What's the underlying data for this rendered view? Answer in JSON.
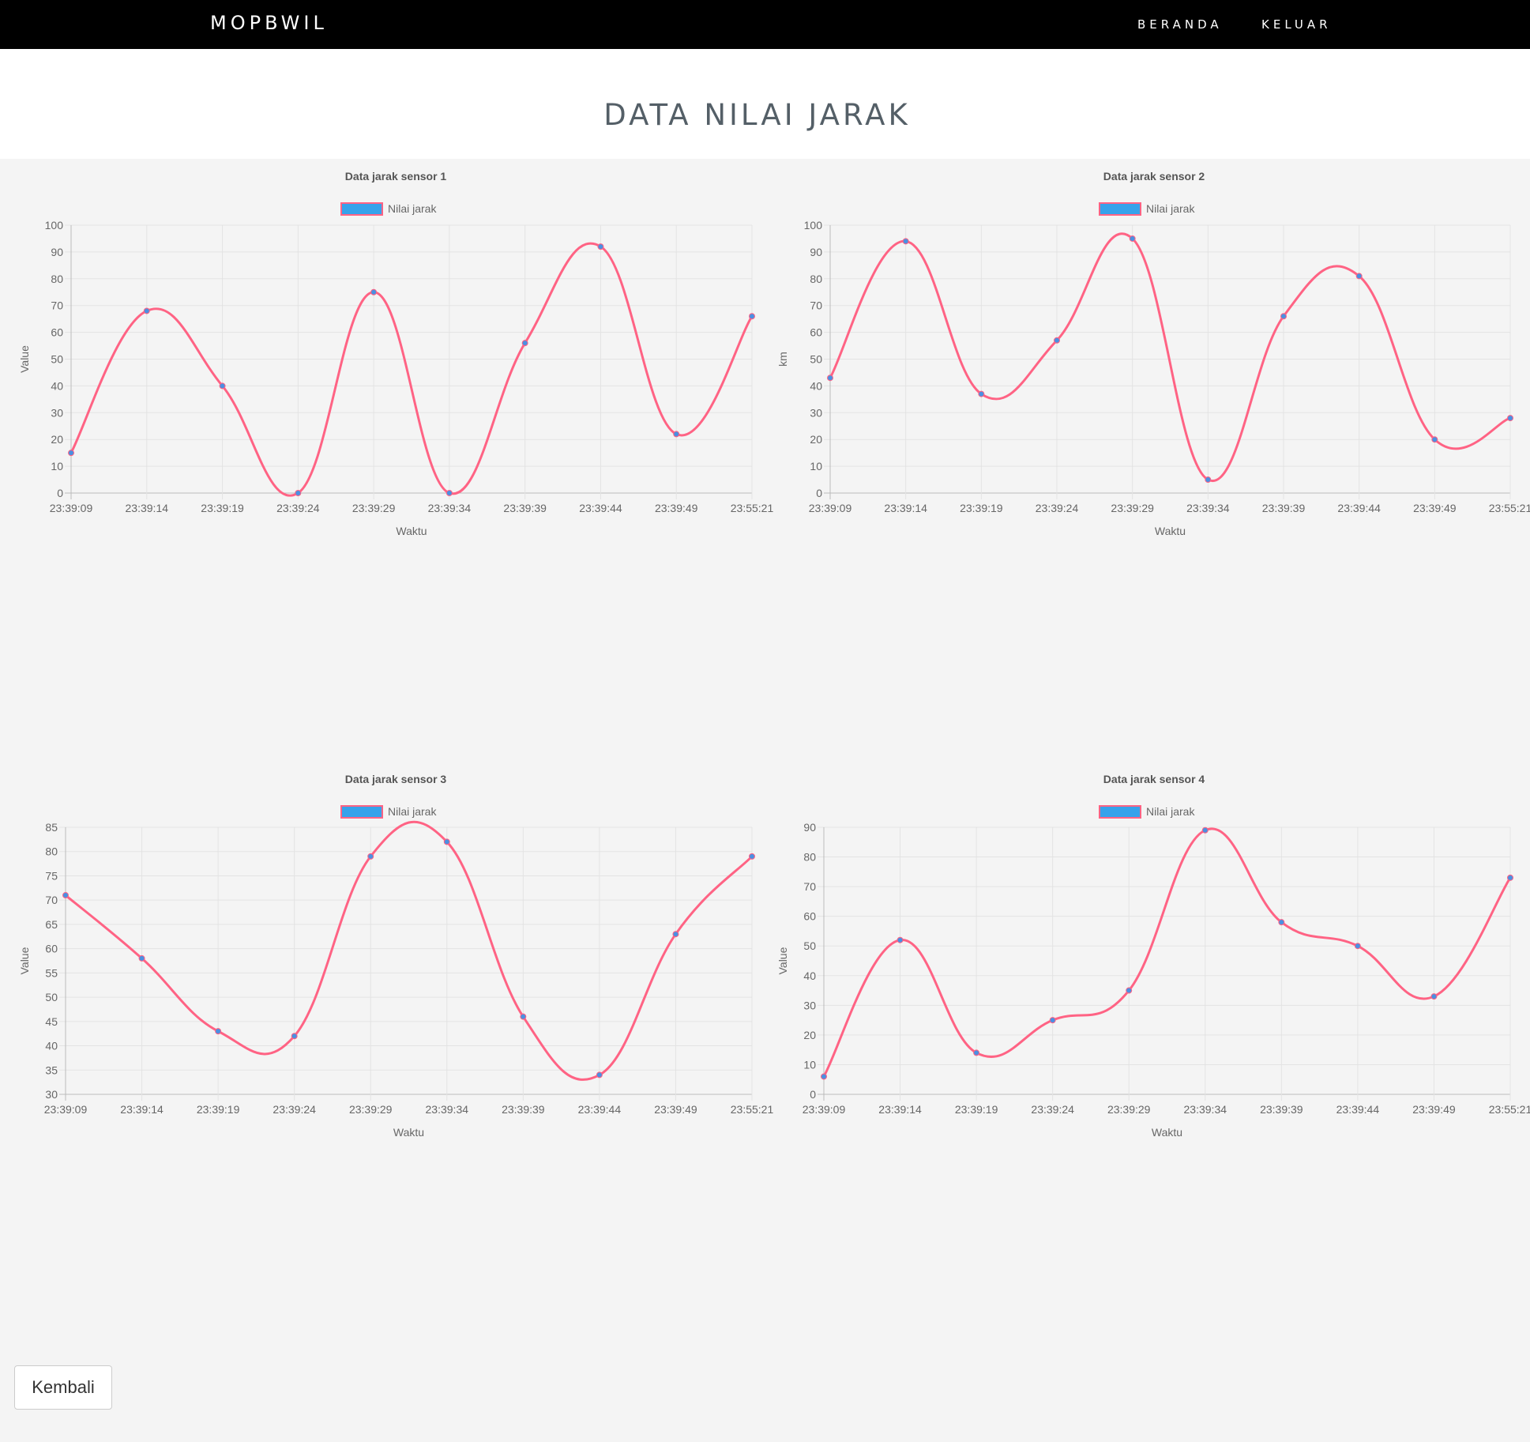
{
  "navbar": {
    "brand": "MOPBWIL",
    "links": [
      "BERANDA",
      "KELUAR"
    ]
  },
  "page_title": "DATA NILAI JARAK",
  "back_button_label": "Kembali",
  "colors": {
    "line": "#ff6384",
    "point": "#4a90e2",
    "legend_fill": "#36a2eb",
    "navbar_bg": "#000000",
    "background": "#f4f4f4"
  },
  "chart_data": [
    {
      "type": "line",
      "title": "Data jarak sensor 1",
      "legend": "Nilai jarak",
      "xlabel": "Waktu",
      "ylabel": "Value",
      "categories": [
        "23:39:09",
        "23:39:14",
        "23:39:19",
        "23:39:24",
        "23:39:29",
        "23:39:34",
        "23:39:39",
        "23:39:44",
        "23:39:49",
        "23:55:21"
      ],
      "series": [
        {
          "name": "Nilai jarak",
          "values": [
            15,
            68,
            40,
            0,
            75,
            0,
            56,
            92,
            22,
            66
          ]
        }
      ],
      "ylim": [
        0,
        100
      ],
      "yticks": [
        0,
        10,
        20,
        30,
        40,
        50,
        60,
        70,
        80,
        90,
        100
      ],
      "grid": true,
      "legend_position": "top"
    },
    {
      "type": "line",
      "title": "Data jarak sensor 2",
      "legend": "Nilai jarak",
      "xlabel": "Waktu",
      "ylabel": "km",
      "categories": [
        "23:39:09",
        "23:39:14",
        "23:39:19",
        "23:39:24",
        "23:39:29",
        "23:39:34",
        "23:39:39",
        "23:39:44",
        "23:39:49",
        "23:55:21"
      ],
      "series": [
        {
          "name": "Nilai jarak",
          "values": [
            43,
            94,
            37,
            57,
            95,
            5,
            66,
            81,
            20,
            28
          ]
        }
      ],
      "ylim": [
        0,
        100
      ],
      "yticks": [
        0,
        10,
        20,
        30,
        40,
        50,
        60,
        70,
        80,
        90,
        100
      ],
      "grid": true,
      "legend_position": "top"
    },
    {
      "type": "line",
      "title": "Data jarak sensor 3",
      "legend": "Nilai jarak",
      "xlabel": "Waktu",
      "ylabel": "Value",
      "categories": [
        "23:39:09",
        "23:39:14",
        "23:39:19",
        "23:39:24",
        "23:39:29",
        "23:39:34",
        "23:39:39",
        "23:39:44",
        "23:39:49",
        "23:55:21"
      ],
      "series": [
        {
          "name": "Nilai jarak",
          "values": [
            71,
            58,
            43,
            42,
            79,
            82,
            46,
            34,
            63,
            79
          ]
        }
      ],
      "ylim": [
        30,
        85
      ],
      "yticks": [
        30,
        35,
        40,
        45,
        50,
        55,
        60,
        65,
        70,
        75,
        80,
        85
      ],
      "grid": true,
      "legend_position": "top"
    },
    {
      "type": "line",
      "title": "Data jarak sensor 4",
      "legend": "Nilai jarak",
      "xlabel": "Waktu",
      "ylabel": "Value",
      "categories": [
        "23:39:09",
        "23:39:14",
        "23:39:19",
        "23:39:24",
        "23:39:29",
        "23:39:34",
        "23:39:39",
        "23:39:44",
        "23:39:49",
        "23:55:21"
      ],
      "series": [
        {
          "name": "Nilai jarak",
          "values": [
            6,
            52,
            14,
            25,
            35,
            89,
            58,
            50,
            33,
            73
          ]
        }
      ],
      "ylim": [
        0,
        90
      ],
      "yticks": [
        0,
        10,
        20,
        30,
        40,
        50,
        60,
        70,
        80,
        90
      ],
      "grid": true,
      "legend_position": "top"
    }
  ]
}
